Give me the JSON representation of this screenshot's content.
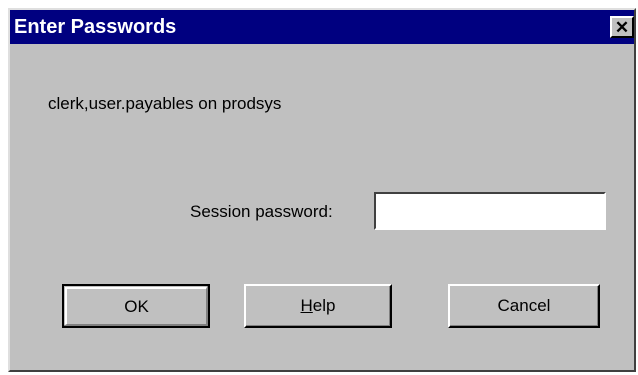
{
  "window": {
    "title": "Enter Passwords",
    "close_glyph": "✕"
  },
  "context": {
    "text": "clerk,user.payables on prodsys"
  },
  "password": {
    "label": "Session password:",
    "value": ""
  },
  "buttons": {
    "ok_label": "OK",
    "help_mnemonic": "H",
    "help_rest": "elp",
    "cancel_label": "Cancel"
  }
}
